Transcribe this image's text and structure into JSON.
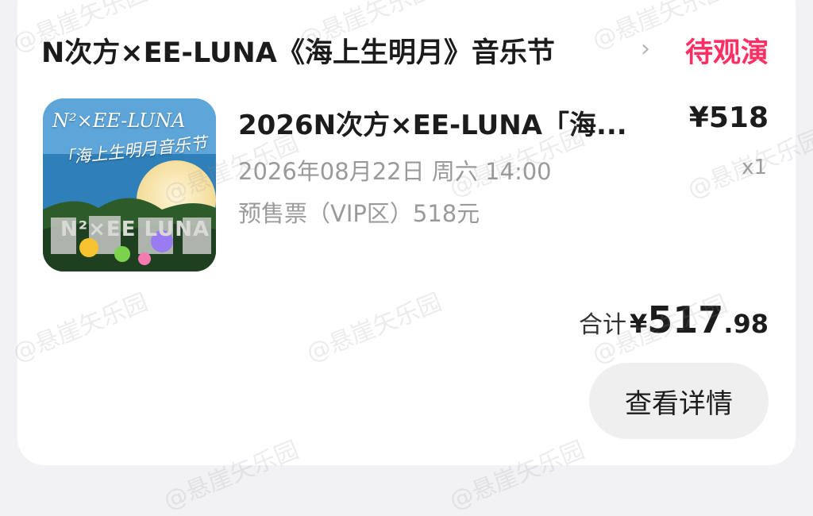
{
  "order": {
    "event_title": "N次方×EE-LUNA《海上生明月》音乐节",
    "chevron": "›",
    "status": "待观演",
    "status_color": "#ff2e63"
  },
  "ticket": {
    "name": "2026N次方×EE-LUNA「海...",
    "price": "¥518",
    "quantity": "x1",
    "datetime": "2026年08月22日 周六 14:00",
    "type": "预售票（VIP区）518元",
    "poster": {
      "title": "N²×EE-LUNA",
      "subtitle": "「海上生明月音乐节",
      "sign": "N²×EE LUNA"
    }
  },
  "total": {
    "label": "合计",
    "currency": "¥",
    "integer": "517",
    "decimal": ".98"
  },
  "actions": {
    "detail_label": "查看详情"
  },
  "watermark": {
    "text": "@悬崖矢乐园"
  }
}
